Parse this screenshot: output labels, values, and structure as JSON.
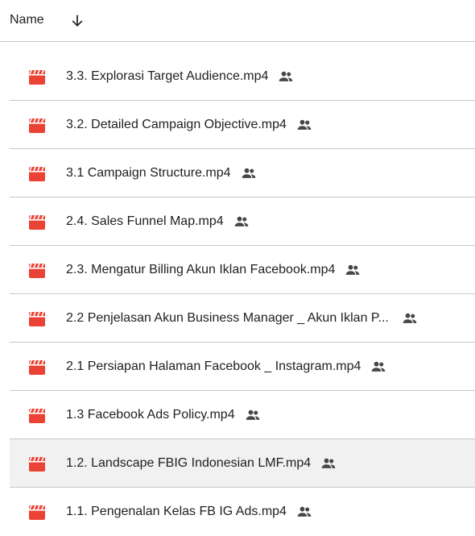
{
  "header": {
    "name_label": "Name",
    "sort_icon": "arrow-down-icon"
  },
  "colors": {
    "video_icon": "#ea4335",
    "shared_icon": "#444746",
    "divider": "#c7c7c7",
    "selected_row": "#f1f1f1"
  },
  "files": [
    {
      "name": "3.3. Explorasi Target Audience.mp4",
      "icon": "video-file-icon",
      "shared": true
    },
    {
      "name": "3.2. Detailed Campaign Objective.mp4",
      "icon": "video-file-icon",
      "shared": true
    },
    {
      "name": "3.1 Campaign Structure.mp4",
      "icon": "video-file-icon",
      "shared": true
    },
    {
      "name": "2.4. Sales Funnel Map.mp4",
      "icon": "video-file-icon",
      "shared": true
    },
    {
      "name": "2.3. Mengatur Billing Akun Iklan Facebook.mp4",
      "icon": "video-file-icon",
      "shared": true
    },
    {
      "name": "2.2 Penjelasan Akun Business Manager _ Akun Iklan P...",
      "icon": "video-file-icon",
      "shared": true
    },
    {
      "name": "2.1 Persiapan Halaman Facebook _ Instagram.mp4",
      "icon": "video-file-icon",
      "shared": true
    },
    {
      "name": "1.3 Facebook Ads Policy.mp4",
      "icon": "video-file-icon",
      "shared": true
    },
    {
      "name": "1.2. Landscape FBIG Indonesian LMF.mp4",
      "icon": "video-file-icon",
      "shared": true,
      "selected": true
    },
    {
      "name": "1.1. Pengenalan Kelas FB IG Ads.mp4",
      "icon": "video-file-icon",
      "shared": true
    }
  ]
}
